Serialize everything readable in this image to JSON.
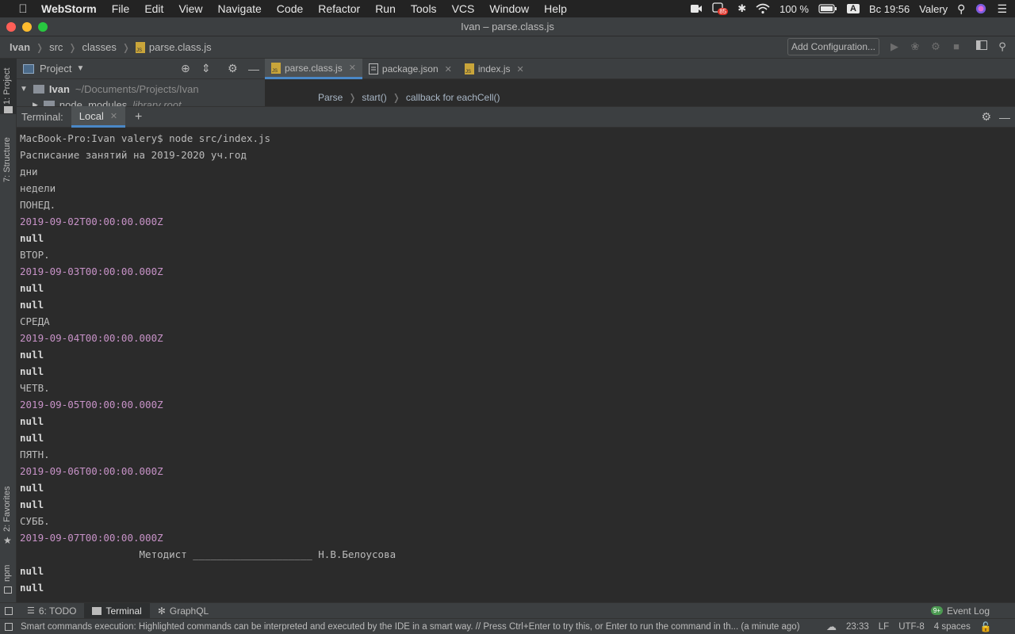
{
  "menubar": {
    "apple": "",
    "items": [
      "WebStorm",
      "File",
      "Edit",
      "View",
      "Navigate",
      "Code",
      "Refactor",
      "Run",
      "Tools",
      "VCS",
      "Window",
      "Help"
    ],
    "tray": {
      "badge": "85",
      "battery": "100 %",
      "input_source": "A",
      "clock": "Вс 19:56",
      "user": "Valery"
    }
  },
  "window": {
    "title": "Ivan – parse.class.js"
  },
  "navbar": {
    "crumbs": [
      "Ivan",
      "src",
      "classes",
      "parse.class.js"
    ],
    "add_config": "Add Configuration..."
  },
  "left_strip": {
    "tabs": [
      "1: Project",
      "7: Structure",
      "2: Favorites",
      "npm"
    ]
  },
  "project_panel": {
    "title": "Project",
    "root_name": "Ivan",
    "root_path": "~/Documents/Projects/Ivan",
    "child_name": "node_modules",
    "child_hint": "library root"
  },
  "editor": {
    "tabs": [
      {
        "label": "parse.class.js",
        "active": true
      },
      {
        "label": "package.json",
        "active": false
      },
      {
        "label": "index.js",
        "active": false
      }
    ],
    "breadcrumb": [
      "Parse",
      "start()",
      "callback for eachCell()"
    ]
  },
  "terminal": {
    "label": "Terminal:",
    "tab": "Local",
    "lines": [
      {
        "text": "MacBook-Pro:Ivan valery$ node src/index.js",
        "kind": "plain"
      },
      {
        "text": "Расписание занятий на 2019-2020 уч.год",
        "kind": "plain"
      },
      {
        "text": "дни",
        "kind": "plain"
      },
      {
        "text": "недели",
        "kind": "plain"
      },
      {
        "text": "ПОНЕД.",
        "kind": "plain"
      },
      {
        "text": "2019-09-02T00:00:00.000Z",
        "kind": "date"
      },
      {
        "text": "null",
        "kind": "nul"
      },
      {
        "text": "ВТОР.",
        "kind": "plain"
      },
      {
        "text": "2019-09-03T00:00:00.000Z",
        "kind": "date"
      },
      {
        "text": "null",
        "kind": "nul"
      },
      {
        "text": "null",
        "kind": "nul"
      },
      {
        "text": "СРЕДА",
        "kind": "plain"
      },
      {
        "text": "2019-09-04T00:00:00.000Z",
        "kind": "date"
      },
      {
        "text": "null",
        "kind": "nul"
      },
      {
        "text": "null",
        "kind": "nul"
      },
      {
        "text": "ЧЕТВ.",
        "kind": "plain"
      },
      {
        "text": "2019-09-05T00:00:00.000Z",
        "kind": "date"
      },
      {
        "text": "null",
        "kind": "nul"
      },
      {
        "text": "null",
        "kind": "nul"
      },
      {
        "text": "ПЯТН.",
        "kind": "plain"
      },
      {
        "text": "2019-09-06T00:00:00.000Z",
        "kind": "date"
      },
      {
        "text": "null",
        "kind": "nul"
      },
      {
        "text": "null",
        "kind": "nul"
      },
      {
        "text": "СУББ.",
        "kind": "plain"
      },
      {
        "text": "2019-09-07T00:00:00.000Z",
        "kind": "date"
      },
      {
        "text": "                    Методист ____________________ Н.В.Белоусова",
        "kind": "plain"
      },
      {
        "text": "null",
        "kind": "nul"
      },
      {
        "text": "null",
        "kind": "nul"
      }
    ]
  },
  "bottom_tools": {
    "todo": "6: TODO",
    "terminal": "Terminal",
    "graphql": "GraphQL",
    "event_log": "Event Log",
    "event_count": "9+"
  },
  "statusbar": {
    "message": "Smart commands execution: Highlighted commands can be interpreted and executed by the IDE in a smart way. // Press Ctrl+Enter to try this, or Enter to run the command in th... (a minute ago)",
    "position": "23:33",
    "line_sep": "LF",
    "encoding": "UTF-8",
    "indent": "4 spaces"
  },
  "colors": {
    "accent": "#4a88c7",
    "date_text": "#c792c7",
    "close_red": "#ff5f57",
    "minimize_yellow": "#febc2e",
    "zoom_green": "#28c840"
  }
}
